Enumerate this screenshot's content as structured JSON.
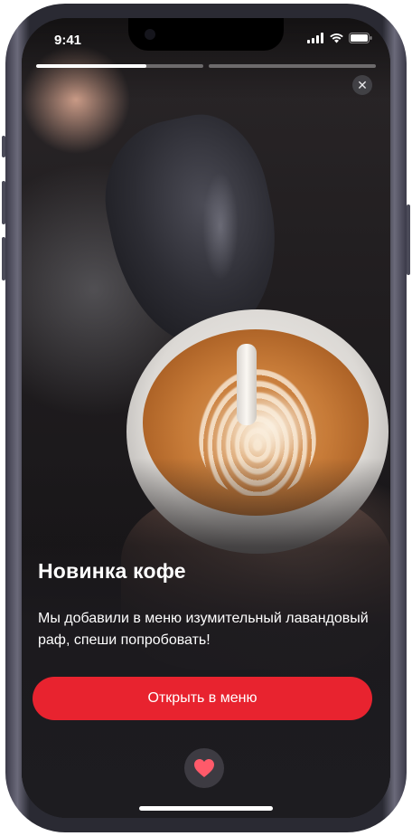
{
  "status_bar": {
    "time": "9:41",
    "icons": [
      "signal-icon",
      "wifi-icon",
      "battery-icon"
    ]
  },
  "story": {
    "progress": [
      0.66,
      0.0
    ],
    "close_icon": "close-icon",
    "title": "Новинка кофе",
    "description": "Мы добавили в меню изумительный лавандовый раф, спеши попробовать!",
    "cta_label": "Открыть в меню",
    "like_icon": "heart-icon"
  },
  "colors": {
    "accent": "#e8232f",
    "like_heart": "#ff5a6a"
  }
}
